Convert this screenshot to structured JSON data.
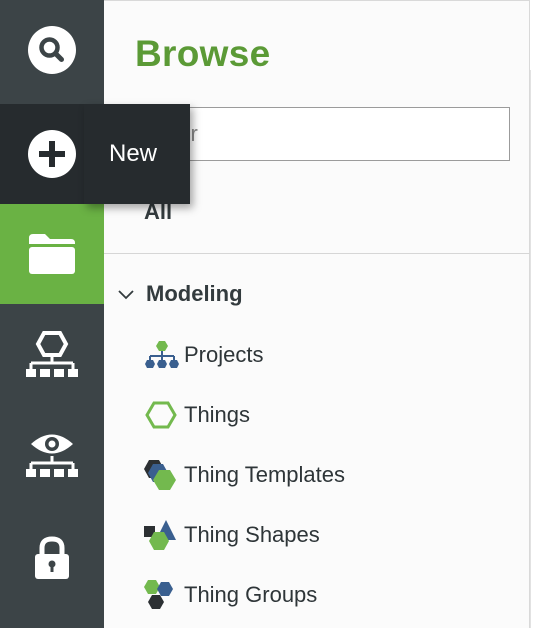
{
  "rail": {
    "items": [
      {
        "icon": "search-icon"
      },
      {
        "icon": "plus-circle-icon",
        "tooltip": "New"
      },
      {
        "icon": "folder-icon"
      },
      {
        "icon": "hierarchy-hexagon-icon"
      },
      {
        "icon": "eye-network-icon"
      },
      {
        "icon": "lock-icon"
      }
    ],
    "active_index": 2,
    "hover_index": 1
  },
  "browse": {
    "title": "Browse",
    "filter_placeholder": "Filter",
    "all_label": "All",
    "section": {
      "label": "Modeling",
      "expanded": true,
      "items": [
        {
          "label": "Projects",
          "icon": "projects-icon"
        },
        {
          "label": "Things",
          "icon": "thing-hexagon-icon"
        },
        {
          "label": "Thing Templates",
          "icon": "thing-templates-icon"
        },
        {
          "label": "Thing Shapes",
          "icon": "thing-shapes-icon"
        },
        {
          "label": "Thing Groups",
          "icon": "thing-groups-icon"
        }
      ]
    }
  },
  "colors": {
    "rail_bg": "#3c4447",
    "active_green": "#6ab244",
    "title_green": "#5b9a36",
    "hex_green": "#73b94e",
    "blue": "#3a5f8f",
    "dark": "#2c3033"
  }
}
